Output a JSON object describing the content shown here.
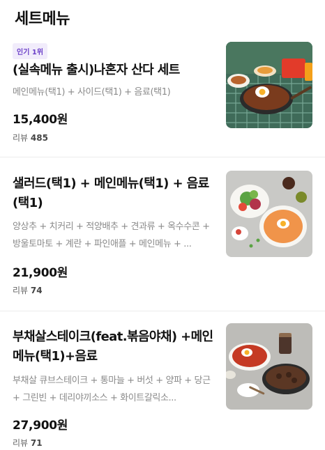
{
  "section": {
    "title": "세트메뉴"
  },
  "items": [
    {
      "badge": "인기 1위",
      "name": "(실속메뉴 출시)나혼자 산다 세트",
      "description": "메인메뉴(택1) + 사이드(택1) + 음료(택1)",
      "price": "15,400원",
      "review_label": "리뷰",
      "review_count": "485"
    },
    {
      "name": "샐러드(택1) + 메인메뉴(택1) + 음료(택1)",
      "description": "양상추 + 치커리 + 적양배추 + 견과류 + 옥수수콘 + 방울토마토 + 계란 + 파인애플 + 메인메뉴 + ...",
      "price": "21,900원",
      "review_label": "리뷰",
      "review_count": "74"
    },
    {
      "name": "부채살스테이크(feat.볶음야채) +메인메뉴(택1)+음료",
      "description": "부채살 큐브스테이크 + 통마늘 + 버섯 + 양파 + 당근 + 그린빈 + 데리야끼소스 + 화이트갈릭소...",
      "price": "27,900원",
      "review_label": "리뷰",
      "review_count": "71"
    }
  ],
  "colors": {
    "badge_bg": "#f1ecfb",
    "badge_text": "#6b3fc8",
    "divider": "#ececec",
    "description": "#8a8a8a"
  }
}
